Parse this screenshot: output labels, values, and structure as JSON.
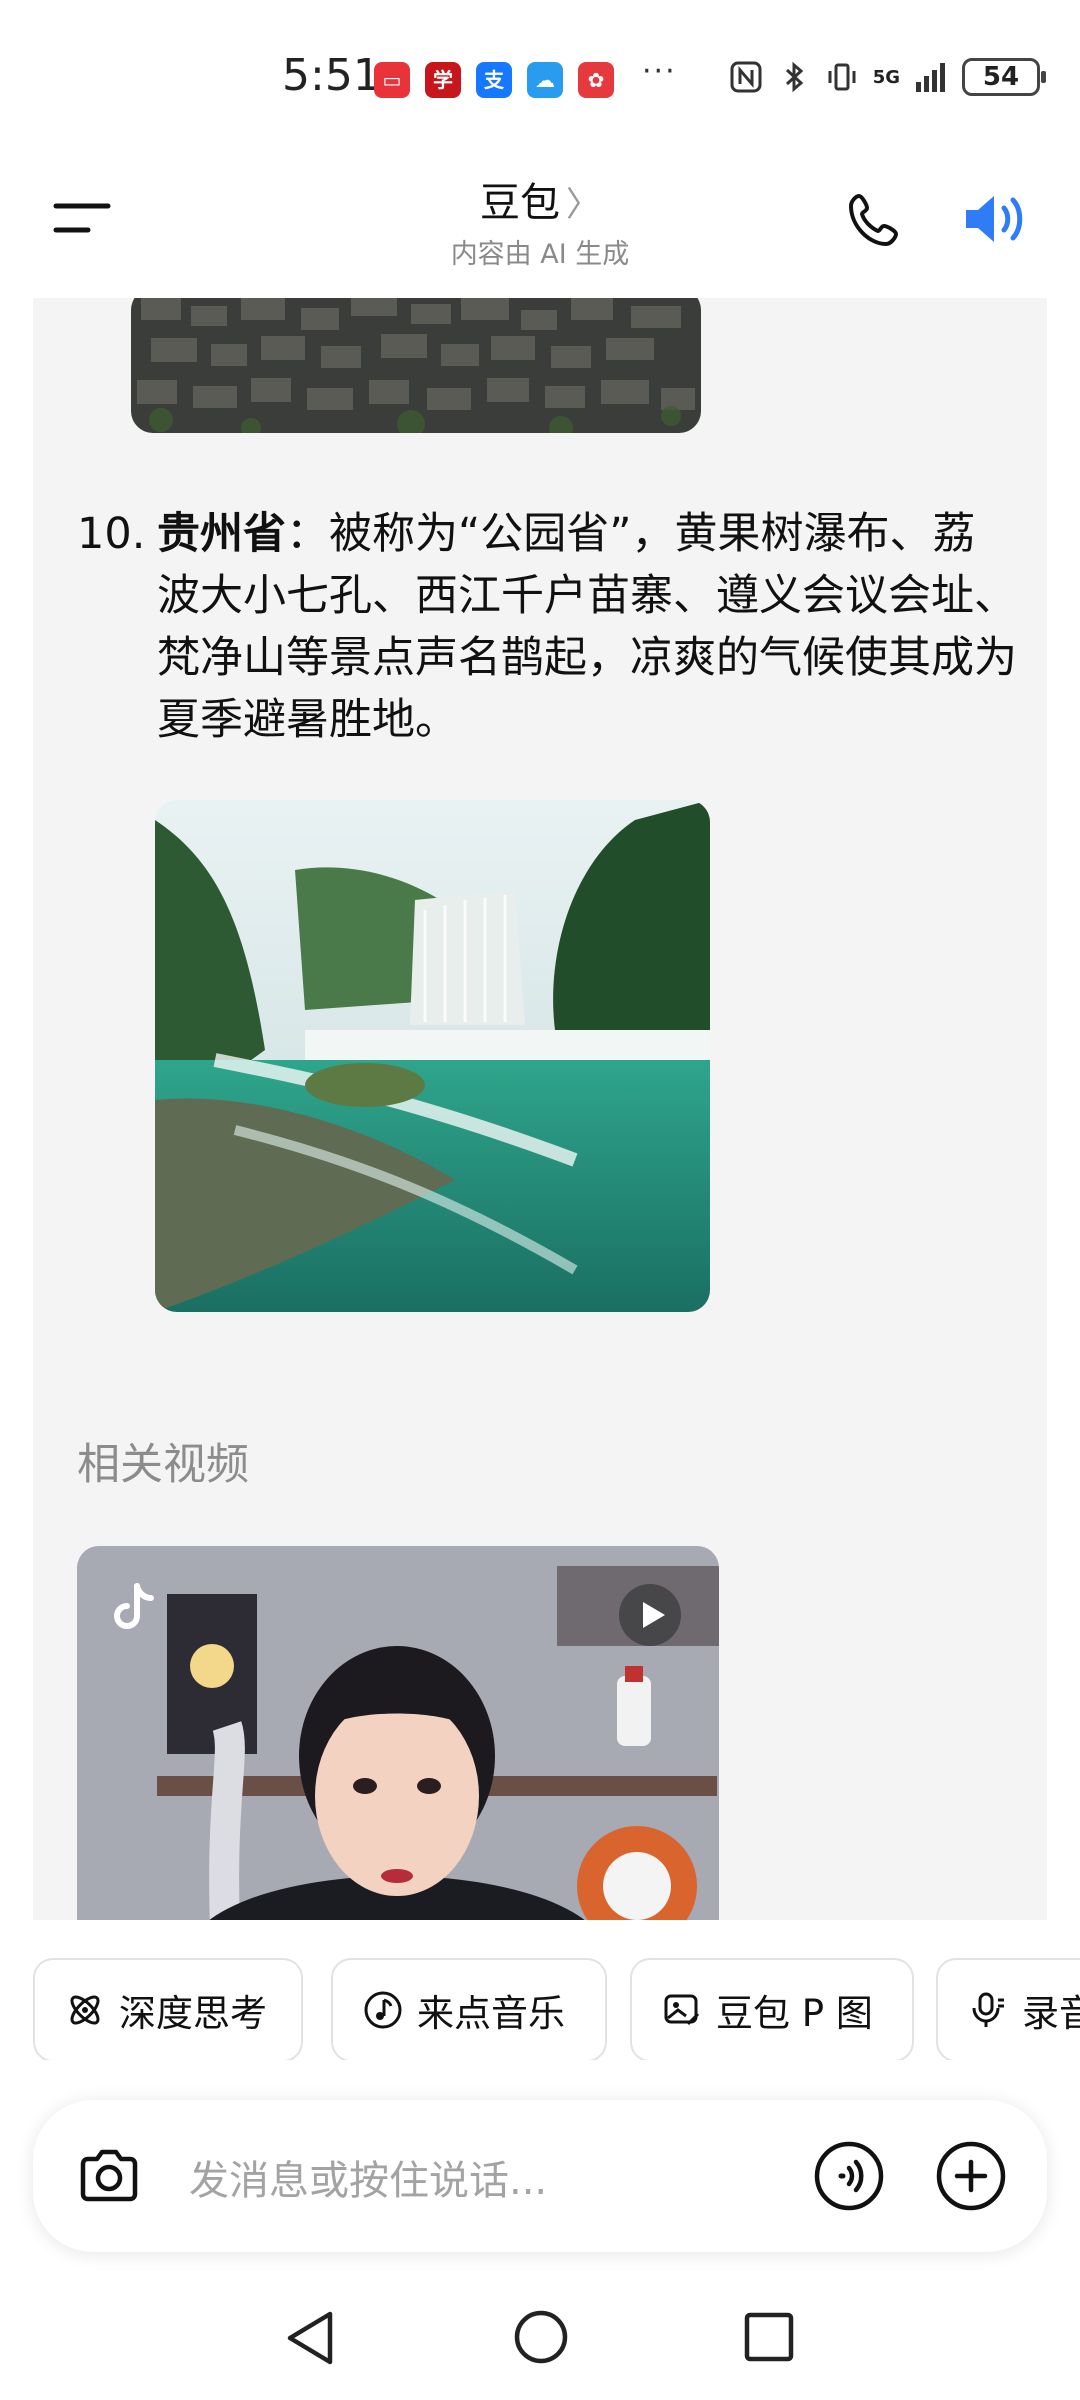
{
  "status_bar": {
    "time": "5:51",
    "more": "···",
    "network": "5G",
    "battery": "54"
  },
  "header": {
    "title": "豆包",
    "chevron": "〉",
    "subtitle": "内容由 AI 生成"
  },
  "chat": {
    "item_number": "10.",
    "item_bold": "贵州省",
    "item_text": "：被称为“公园省”，黄果树瀑布、荔波大小七孔、西江千户苗寨、遵义会议会址、梵净山等景点声名鹊起，凉爽的气候使其成为夏季避暑胜地。",
    "related_videos_label": "相关视频"
  },
  "chips": [
    {
      "label": "深度思考",
      "icon": "atom-icon"
    },
    {
      "label": "来点音乐",
      "icon": "music-note-icon"
    },
    {
      "label": "豆包 P 图",
      "icon": "image-edit-icon"
    },
    {
      "label": "录音",
      "icon": "mic-icon"
    }
  ],
  "input": {
    "placeholder": "发消息或按住说话..."
  },
  "colors": {
    "accent_blue": "#2f7cf6",
    "chat_bg": "#f4f4f5"
  }
}
